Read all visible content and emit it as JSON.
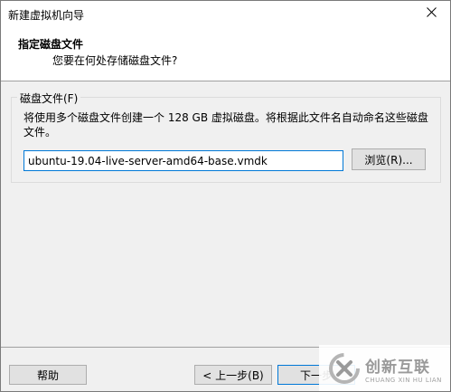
{
  "window": {
    "title": "新建虚拟机向导"
  },
  "header": {
    "title": "指定磁盘文件",
    "subtitle": "您要在何处存储磁盘文件?"
  },
  "disk_file": {
    "group_label": "磁盘文件(F)",
    "description": "将使用多个磁盘文件创建一个 128 GB 虚拟磁盘。将根据此文件名自动命名这些磁盘文件。",
    "path_value": "ubuntu-19.04-live-server-amd64-base.vmdk",
    "browse_label": "浏览(R)..."
  },
  "footer": {
    "help_label": "帮助",
    "prev_label": "< 上一步(B)",
    "next_label": "下一步"
  },
  "watermark": {
    "brand_cn": "创新互联",
    "brand_en": "CHUANG XIN HU LIAN"
  },
  "colors": {
    "accent": "#0078d7",
    "window_bg": "#f0f0f0"
  },
  "icons": {
    "close": "close-icon",
    "watermark_logo": "brand-logo-icon"
  }
}
